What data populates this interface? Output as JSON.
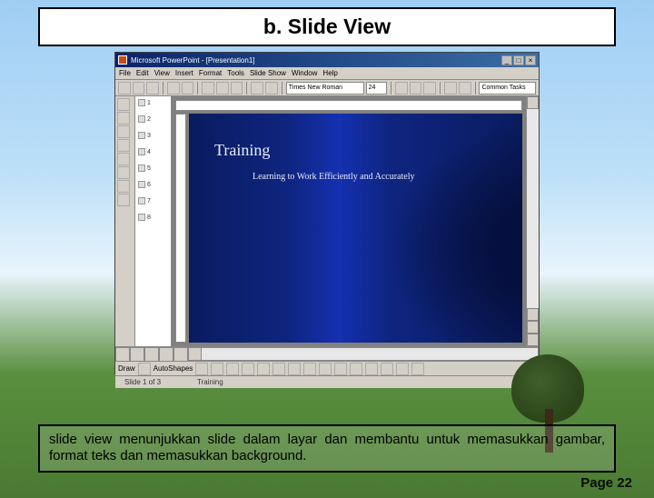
{
  "header": {
    "title": "b. Slide View"
  },
  "screenshot": {
    "window_title": "Microsoft PowerPoint - [Presentation1]",
    "menu": [
      "File",
      "Edit",
      "View",
      "Insert",
      "Format",
      "Tools",
      "Slide Show",
      "Window",
      "Help"
    ],
    "toolbar2": {
      "font_name": "Times New Roman",
      "font_size": "24",
      "common_tasks": "Common Tasks"
    },
    "outline_numbers": [
      "1",
      "2",
      "3",
      "4",
      "5",
      "6",
      "7",
      "8"
    ],
    "slide": {
      "title": "Training",
      "body": "Learning to Work Efficiently and Accurately"
    },
    "draw_toolbar": {
      "draw_label": "Draw",
      "autoshapes_label": "AutoShapes"
    },
    "status": {
      "left": "Slide 1 of 3",
      "center": "Training"
    },
    "window_buttons": {
      "min": "_",
      "max": "□",
      "close": "×"
    }
  },
  "description": "slide view menunjukkan slide dalam layar dan membantu untuk memasukkan gambar, format teks dan memasukkan background.",
  "footer": {
    "page_label": "Page 22"
  }
}
